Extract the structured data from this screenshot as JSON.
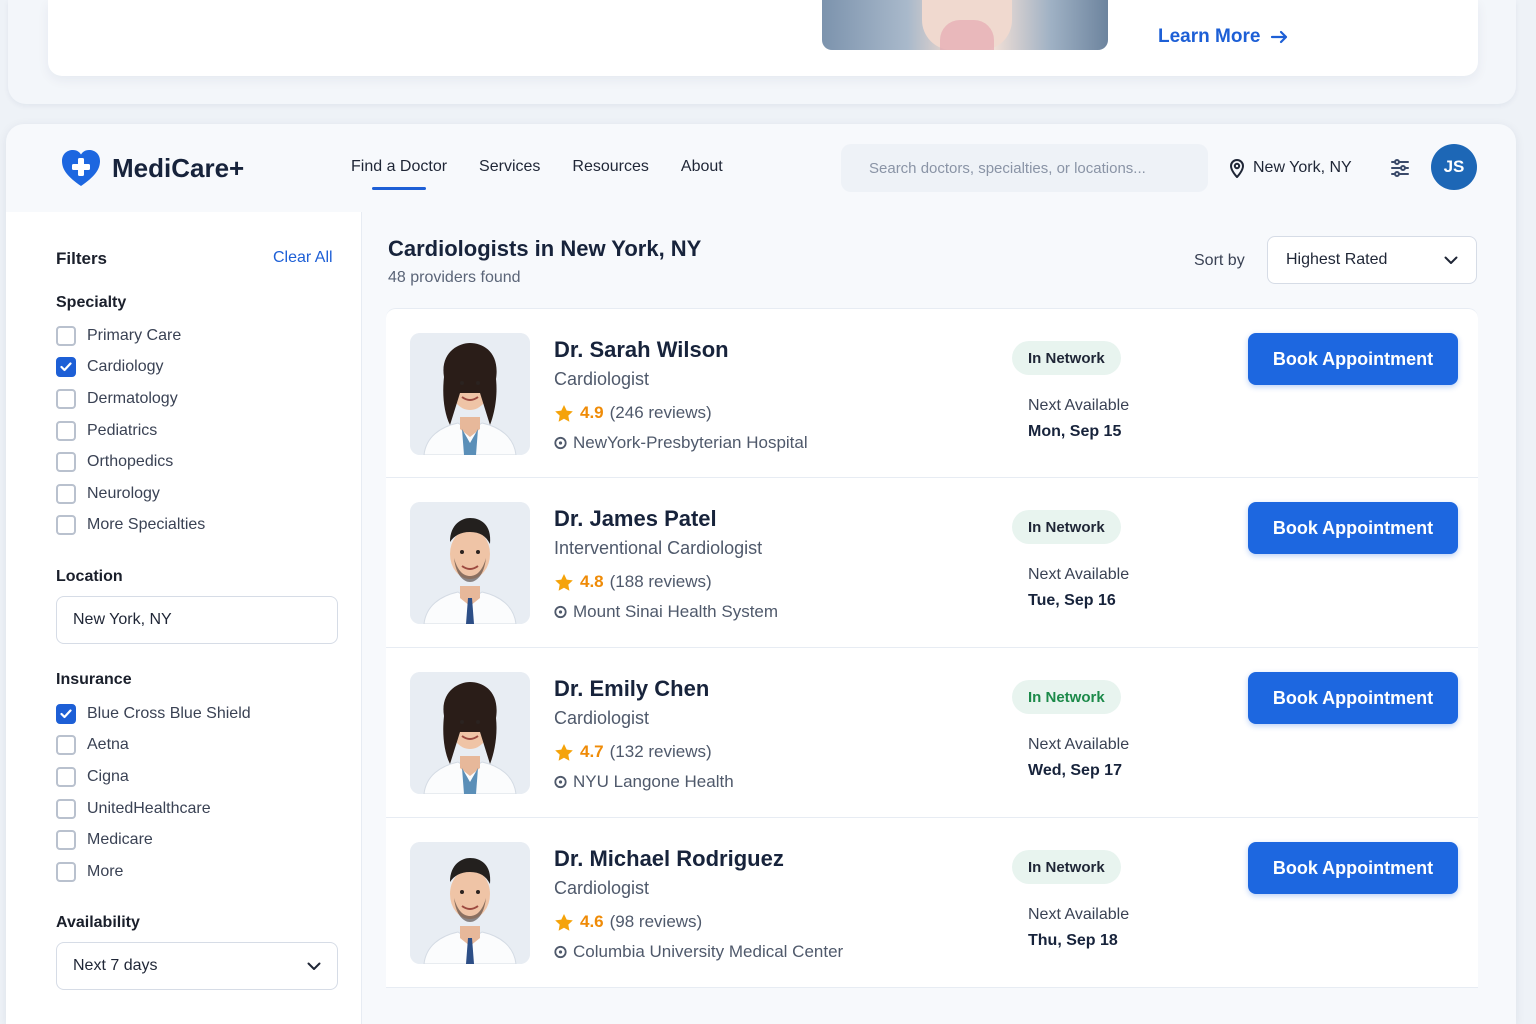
{
  "promo": {
    "learn_more": "Learn More"
  },
  "header": {
    "brand": "MediCare+",
    "nav": [
      {
        "label": "Find a Doctor",
        "active": true
      },
      {
        "label": "Services"
      },
      {
        "label": "Resources"
      },
      {
        "label": "About"
      }
    ],
    "search_placeholder": "Search doctors, specialties, or locations...",
    "location": "New York, NY",
    "avatar_initials": "JS"
  },
  "filters": {
    "title": "Filters",
    "clear_all": "Clear All",
    "specialty": {
      "title": "Specialty",
      "options": [
        {
          "label": "Primary Care",
          "checked": false
        },
        {
          "label": "Cardiology",
          "checked": true
        },
        {
          "label": "Dermatology",
          "checked": false
        },
        {
          "label": "Pediatrics",
          "checked": false
        },
        {
          "label": "Orthopedics",
          "checked": false
        },
        {
          "label": "Neurology",
          "checked": false
        },
        {
          "label": "More Specialties",
          "checked": false
        }
      ]
    },
    "location": {
      "title": "Location",
      "value": "New York, NY"
    },
    "insurance": {
      "title": "Insurance",
      "options": [
        {
          "label": "Blue Cross Blue Shield",
          "checked": true
        },
        {
          "label": "Aetna",
          "checked": false
        },
        {
          "label": "Cigna",
          "checked": false
        },
        {
          "label": "UnitedHealthcare",
          "checked": false
        },
        {
          "label": "Medicare",
          "checked": false
        },
        {
          "label": "More",
          "checked": false
        }
      ]
    },
    "availability": {
      "title": "Availability",
      "value": "Next 7 days"
    }
  },
  "results": {
    "title": "Cardiologists in New York, NY",
    "count": "48 providers found",
    "sort_label": "Sort by",
    "sort_value": "Highest Rated",
    "doctors": [
      {
        "name": "Dr. Sarah Wilson",
        "specialty": "Cardiologist",
        "rating": "4.9",
        "reviews": "(246 reviews)",
        "hospital": "NewYork-Presbyterian Hospital",
        "network": "In Network",
        "next_label": "Next Available",
        "next_date": "Mon, Sep 15",
        "book": "Book Appointment",
        "gender": "f"
      },
      {
        "name": "Dr. James Patel",
        "specialty": "Interventional Cardiologist",
        "rating": "4.8",
        "reviews": "(188 reviews)",
        "hospital": "Mount Sinai Health System",
        "network": "In Network",
        "next_label": "Next Available",
        "next_date": "Tue, Sep 16",
        "book": "Book Appointment",
        "gender": "m"
      },
      {
        "name": "Dr. Emily Chen",
        "specialty": "Cardiologist",
        "rating": "4.7",
        "reviews": "(132 reviews)",
        "hospital": "NYU Langone Health",
        "network": "In Network",
        "network_green": true,
        "next_label": "Next Available",
        "next_date": "Wed, Sep 17",
        "book": "Book Appointment",
        "gender": "f"
      },
      {
        "name": "Dr. Michael Rodriguez",
        "specialty": "Cardiologist",
        "rating": "4.6",
        "reviews": "(98 reviews)",
        "hospital": "Columbia University Medical Center",
        "network": "In Network",
        "next_label": "Next Available",
        "next_date": "Thu, Sep 18",
        "book": "Book Appointment",
        "gender": "m"
      }
    ]
  },
  "colors": {
    "accent": "#1d5fd6",
    "star": "#ef8b07",
    "badge_bg": "#e8f4ef",
    "network_green": "#1c8a4a"
  }
}
